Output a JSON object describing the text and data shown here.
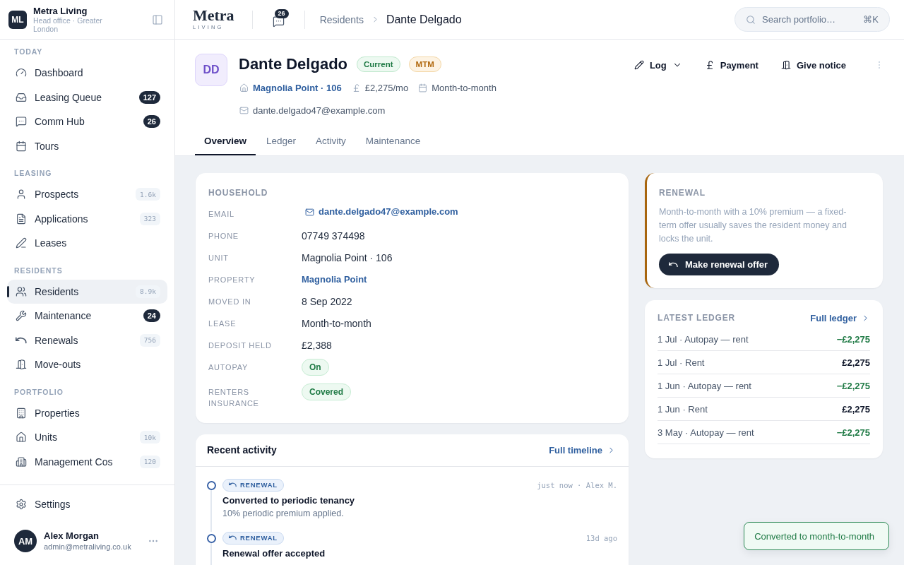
{
  "sidebar": {
    "brand": {
      "initials": "ML",
      "name": "Metra Living",
      "subtitle": "Head office · Greater London"
    },
    "sections": [
      {
        "title": "TODAY",
        "items": [
          {
            "label": "Dashboard",
            "selected": false
          },
          {
            "label": "Leasing Queue",
            "selected": false,
            "badge": {
              "text": "127",
              "kind": "alert"
            }
          },
          {
            "label": "Comm Hub",
            "selected": false,
            "badge": {
              "text": "26",
              "kind": "alert"
            }
          },
          {
            "label": "Tours",
            "selected": false
          }
        ]
      },
      {
        "title": "LEASING",
        "items": [
          {
            "label": "Prospects",
            "selected": false,
            "badge": {
              "text": "1.6k",
              "kind": "count"
            }
          },
          {
            "label": "Applications",
            "selected": false,
            "badge": {
              "text": "323",
              "kind": "count"
            }
          },
          {
            "label": "Leases",
            "selected": false
          }
        ]
      },
      {
        "title": "RESIDENTS",
        "items": [
          {
            "label": "Residents",
            "selected": true,
            "badge": {
              "text": "8.9k",
              "kind": "count"
            }
          },
          {
            "label": "Maintenance",
            "selected": false,
            "badge": {
              "text": "24",
              "kind": "alert"
            }
          },
          {
            "label": "Renewals",
            "selected": false,
            "badge": {
              "text": "756",
              "kind": "count"
            }
          },
          {
            "label": "Move-outs",
            "selected": false
          }
        ]
      },
      {
        "title": "PORTFOLIO",
        "items": [
          {
            "label": "Properties",
            "selected": false
          },
          {
            "label": "Units",
            "selected": false,
            "badge": {
              "text": "10k",
              "kind": "count"
            }
          },
          {
            "label": "Management Cos",
            "selected": false,
            "badge": {
              "text": "120",
              "kind": "count"
            }
          }
        ]
      }
    ],
    "settings": {
      "label": "Settings",
      "selected": false
    },
    "user": {
      "initials": "AM",
      "name": "Alex Morgan",
      "email": "admin@metraliving.co.uk"
    }
  },
  "topbar": {
    "logo": {
      "name": "Metra",
      "tagline": "LIVING"
    },
    "messages_count": "26",
    "breadcrumb": {
      "parent": "Residents",
      "current": "Dante Delgado"
    },
    "search": {
      "placeholder": "Search portfolio…",
      "shortcut": "⌘K"
    }
  },
  "resident": {
    "initials": "DD",
    "name": "Dante Delgado",
    "statuses": [
      {
        "text": "Current",
        "kind": "success"
      },
      {
        "text": "MTM",
        "kind": "warning"
      }
    ],
    "unit": "Magnolia Point · 106",
    "rent": "£2,275/mo",
    "lease_type": "Month-to-month",
    "email": "dante.delgado47@example.com",
    "actions": [
      {
        "label": "Log",
        "kind": "menu"
      },
      {
        "label": "Payment",
        "kind": "plain"
      },
      {
        "label": "Give notice",
        "kind": "plain"
      }
    ]
  },
  "tabs": [
    {
      "label": "Overview",
      "selected": true
    },
    {
      "label": "Ledger",
      "selected": false
    },
    {
      "label": "Activity",
      "selected": false
    },
    {
      "label": "Maintenance",
      "selected": false
    }
  ],
  "household": {
    "title": "HOUSEHOLD",
    "fields": [
      {
        "label": "EMAIL",
        "value": "dante.delgado47@example.com",
        "kind": "email"
      },
      {
        "label": "PHONE",
        "value": "07749 374498",
        "kind": "text"
      },
      {
        "label": "UNIT",
        "value": "Magnolia Point · 106",
        "kind": "text"
      },
      {
        "label": "PROPERTY",
        "value": "Magnolia Point",
        "kind": "link"
      },
      {
        "label": "MOVED IN",
        "value": "8 Sep 2022",
        "kind": "text"
      },
      {
        "label": "LEASE",
        "value": "Month-to-month",
        "kind": "text"
      },
      {
        "label": "DEPOSIT HELD",
        "value": "£2,388",
        "kind": "text"
      },
      {
        "label": "AUTOPAY",
        "value": "On",
        "kind": "pill"
      },
      {
        "label": "RENTERS INSURANCE",
        "value": "Covered",
        "kind": "pill"
      }
    ]
  },
  "activity": {
    "title": "Recent activity",
    "link": "Full timeline",
    "items": [
      {
        "tag": "RENEWAL",
        "time": "just now · Alex M.",
        "title": "Converted to periodic tenancy",
        "detail": "10% periodic premium applied."
      },
      {
        "tag": "RENEWAL",
        "time": "13d ago",
        "title": "Renewal offer accepted"
      }
    ]
  },
  "renewal": {
    "title": "RENEWAL",
    "text": "Month-to-month with a 10% premium — a fixed-term offer usually saves the resident money and locks the unit.",
    "button": "Make renewal offer"
  },
  "ledger": {
    "title": "LATEST LEDGER",
    "link": "Full ledger",
    "rows": [
      {
        "description": "1 Jul · Autopay — rent",
        "amount": "−£2,275",
        "kind": "credit"
      },
      {
        "description": "1 Jul · Rent",
        "amount": "£2,275",
        "kind": "charge"
      },
      {
        "description": "1 Jun · Autopay — rent",
        "amount": "−£2,275",
        "kind": "credit"
      },
      {
        "description": "1 Jun · Rent",
        "amount": "£2,275",
        "kind": "charge"
      },
      {
        "description": "3 May · Autopay — rent",
        "amount": "−£2,275",
        "kind": "credit"
      }
    ]
  },
  "toast": {
    "message": "Converted to month-to-month"
  }
}
